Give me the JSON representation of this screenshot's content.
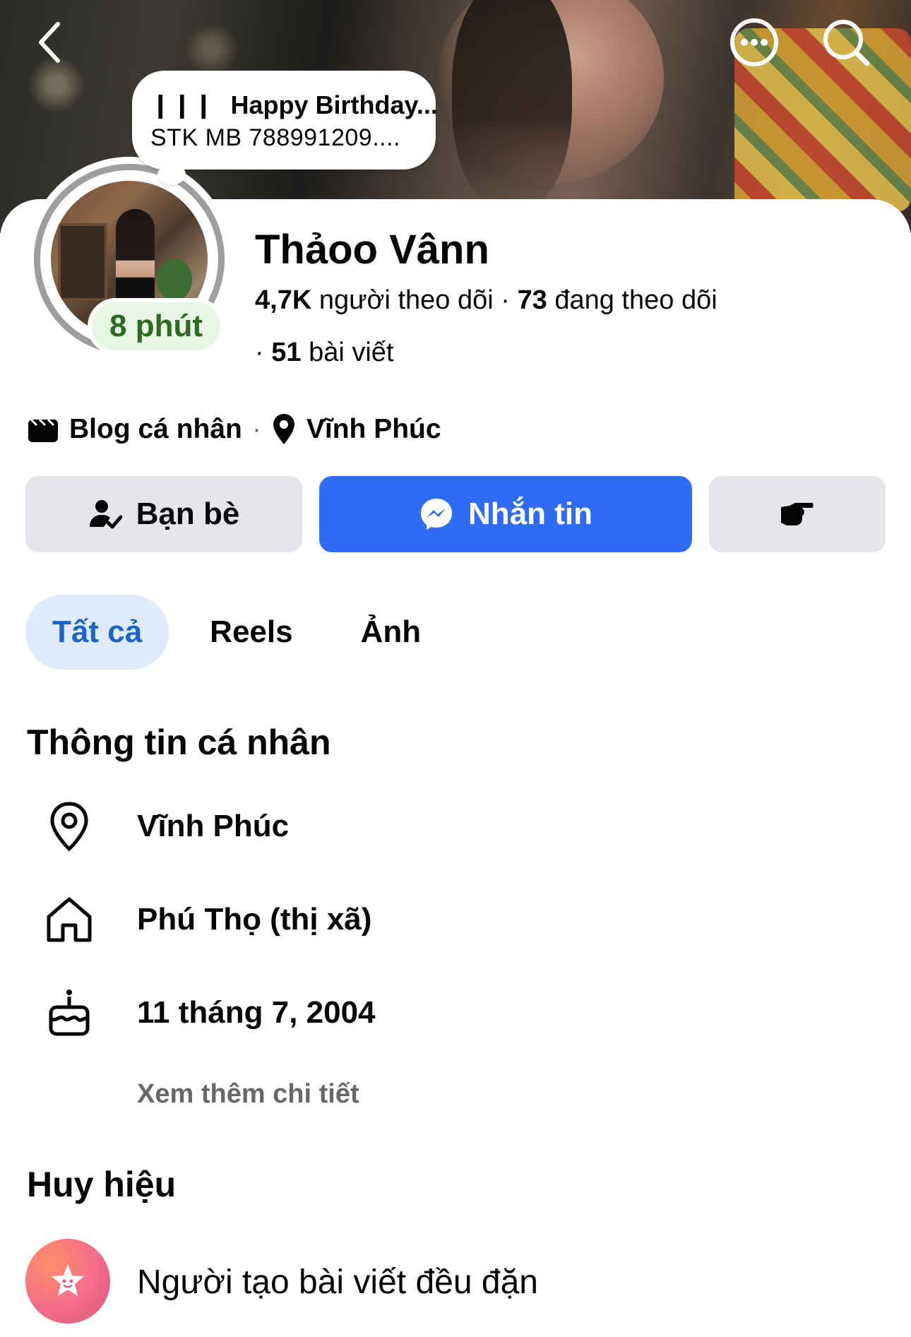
{
  "header": {
    "back_icon": "chevron-left-icon",
    "more_icon": "more-dots-icon",
    "search_icon": "search-icon"
  },
  "note": {
    "line1": "Happy Birthday...",
    "line2": "STK MB 788991209....",
    "music_icon": "music-bars-icon"
  },
  "profile": {
    "name": "Thảoo Vânn",
    "status_time": "8 phút",
    "followers_count": "4,7K",
    "followers_label": "người theo dõi",
    "following_count": "73",
    "following_label": "đang theo dõi",
    "posts_count": "51",
    "posts_label": "bài viết",
    "category": "Blog cá nhân",
    "location": "Vĩnh Phúc"
  },
  "actions": {
    "friends_label": "Bạn bè",
    "message_label": "Nhắn tin",
    "poke_icon": "poke-hand-icon"
  },
  "tabs": [
    {
      "label": "Tất cả",
      "active": true
    },
    {
      "label": "Reels",
      "active": false
    },
    {
      "label": "Ảnh",
      "active": false
    }
  ],
  "about": {
    "title": "Thông tin cá nhân",
    "items": [
      {
        "icon": "location-pin-icon",
        "text": "Vĩnh Phúc"
      },
      {
        "icon": "home-icon",
        "text": "Phú Thọ (thị xã)"
      },
      {
        "icon": "birthday-cake-icon",
        "text": "11 tháng 7, 2004"
      }
    ],
    "see_more": "Xem thêm chi tiết"
  },
  "badges": {
    "title": "Huy hiệu",
    "items": [
      {
        "icon": "star-badge-icon",
        "text": "Người tạo bài viết đều đặn"
      }
    ]
  },
  "colors": {
    "primary_blue": "#2f6cf5",
    "active_tab_bg": "#dfeafc",
    "active_tab_text": "#1d62c6",
    "status_green": "#2f6a22",
    "status_green_bg": "#e7f6e5",
    "secondary_button_bg": "#e4e6eb"
  }
}
